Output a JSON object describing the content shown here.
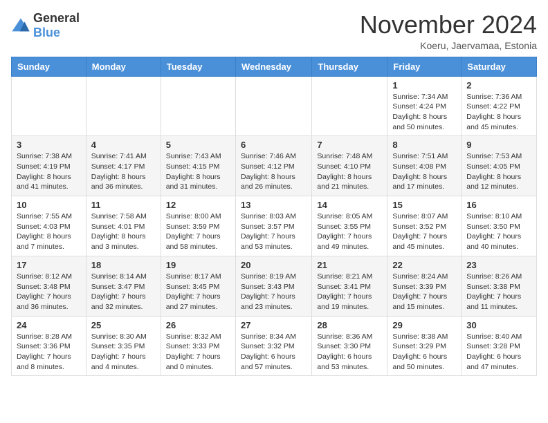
{
  "logo": {
    "general": "General",
    "blue": "Blue"
  },
  "header": {
    "month_year": "November 2024",
    "location": "Koeru, Jaervamaa, Estonia"
  },
  "weekdays": [
    "Sunday",
    "Monday",
    "Tuesday",
    "Wednesday",
    "Thursday",
    "Friday",
    "Saturday"
  ],
  "weeks": [
    [
      {
        "day": "",
        "info": ""
      },
      {
        "day": "",
        "info": ""
      },
      {
        "day": "",
        "info": ""
      },
      {
        "day": "",
        "info": ""
      },
      {
        "day": "",
        "info": ""
      },
      {
        "day": "1",
        "info": "Sunrise: 7:34 AM\nSunset: 4:24 PM\nDaylight: 8 hours and 50 minutes."
      },
      {
        "day": "2",
        "info": "Sunrise: 7:36 AM\nSunset: 4:22 PM\nDaylight: 8 hours and 45 minutes."
      }
    ],
    [
      {
        "day": "3",
        "info": "Sunrise: 7:38 AM\nSunset: 4:19 PM\nDaylight: 8 hours and 41 minutes."
      },
      {
        "day": "4",
        "info": "Sunrise: 7:41 AM\nSunset: 4:17 PM\nDaylight: 8 hours and 36 minutes."
      },
      {
        "day": "5",
        "info": "Sunrise: 7:43 AM\nSunset: 4:15 PM\nDaylight: 8 hours and 31 minutes."
      },
      {
        "day": "6",
        "info": "Sunrise: 7:46 AM\nSunset: 4:12 PM\nDaylight: 8 hours and 26 minutes."
      },
      {
        "day": "7",
        "info": "Sunrise: 7:48 AM\nSunset: 4:10 PM\nDaylight: 8 hours and 21 minutes."
      },
      {
        "day": "8",
        "info": "Sunrise: 7:51 AM\nSunset: 4:08 PM\nDaylight: 8 hours and 17 minutes."
      },
      {
        "day": "9",
        "info": "Sunrise: 7:53 AM\nSunset: 4:05 PM\nDaylight: 8 hours and 12 minutes."
      }
    ],
    [
      {
        "day": "10",
        "info": "Sunrise: 7:55 AM\nSunset: 4:03 PM\nDaylight: 8 hours and 7 minutes."
      },
      {
        "day": "11",
        "info": "Sunrise: 7:58 AM\nSunset: 4:01 PM\nDaylight: 8 hours and 3 minutes."
      },
      {
        "day": "12",
        "info": "Sunrise: 8:00 AM\nSunset: 3:59 PM\nDaylight: 7 hours and 58 minutes."
      },
      {
        "day": "13",
        "info": "Sunrise: 8:03 AM\nSunset: 3:57 PM\nDaylight: 7 hours and 53 minutes."
      },
      {
        "day": "14",
        "info": "Sunrise: 8:05 AM\nSunset: 3:55 PM\nDaylight: 7 hours and 49 minutes."
      },
      {
        "day": "15",
        "info": "Sunrise: 8:07 AM\nSunset: 3:52 PM\nDaylight: 7 hours and 45 minutes."
      },
      {
        "day": "16",
        "info": "Sunrise: 8:10 AM\nSunset: 3:50 PM\nDaylight: 7 hours and 40 minutes."
      }
    ],
    [
      {
        "day": "17",
        "info": "Sunrise: 8:12 AM\nSunset: 3:48 PM\nDaylight: 7 hours and 36 minutes."
      },
      {
        "day": "18",
        "info": "Sunrise: 8:14 AM\nSunset: 3:47 PM\nDaylight: 7 hours and 32 minutes."
      },
      {
        "day": "19",
        "info": "Sunrise: 8:17 AM\nSunset: 3:45 PM\nDaylight: 7 hours and 27 minutes."
      },
      {
        "day": "20",
        "info": "Sunrise: 8:19 AM\nSunset: 3:43 PM\nDaylight: 7 hours and 23 minutes."
      },
      {
        "day": "21",
        "info": "Sunrise: 8:21 AM\nSunset: 3:41 PM\nDaylight: 7 hours and 19 minutes."
      },
      {
        "day": "22",
        "info": "Sunrise: 8:24 AM\nSunset: 3:39 PM\nDaylight: 7 hours and 15 minutes."
      },
      {
        "day": "23",
        "info": "Sunrise: 8:26 AM\nSunset: 3:38 PM\nDaylight: 7 hours and 11 minutes."
      }
    ],
    [
      {
        "day": "24",
        "info": "Sunrise: 8:28 AM\nSunset: 3:36 PM\nDaylight: 7 hours and 8 minutes."
      },
      {
        "day": "25",
        "info": "Sunrise: 8:30 AM\nSunset: 3:35 PM\nDaylight: 7 hours and 4 minutes."
      },
      {
        "day": "26",
        "info": "Sunrise: 8:32 AM\nSunset: 3:33 PM\nDaylight: 7 hours and 0 minutes."
      },
      {
        "day": "27",
        "info": "Sunrise: 8:34 AM\nSunset: 3:32 PM\nDaylight: 6 hours and 57 minutes."
      },
      {
        "day": "28",
        "info": "Sunrise: 8:36 AM\nSunset: 3:30 PM\nDaylight: 6 hours and 53 minutes."
      },
      {
        "day": "29",
        "info": "Sunrise: 8:38 AM\nSunset: 3:29 PM\nDaylight: 6 hours and 50 minutes."
      },
      {
        "day": "30",
        "info": "Sunrise: 8:40 AM\nSunset: 3:28 PM\nDaylight: 6 hours and 47 minutes."
      }
    ]
  ]
}
